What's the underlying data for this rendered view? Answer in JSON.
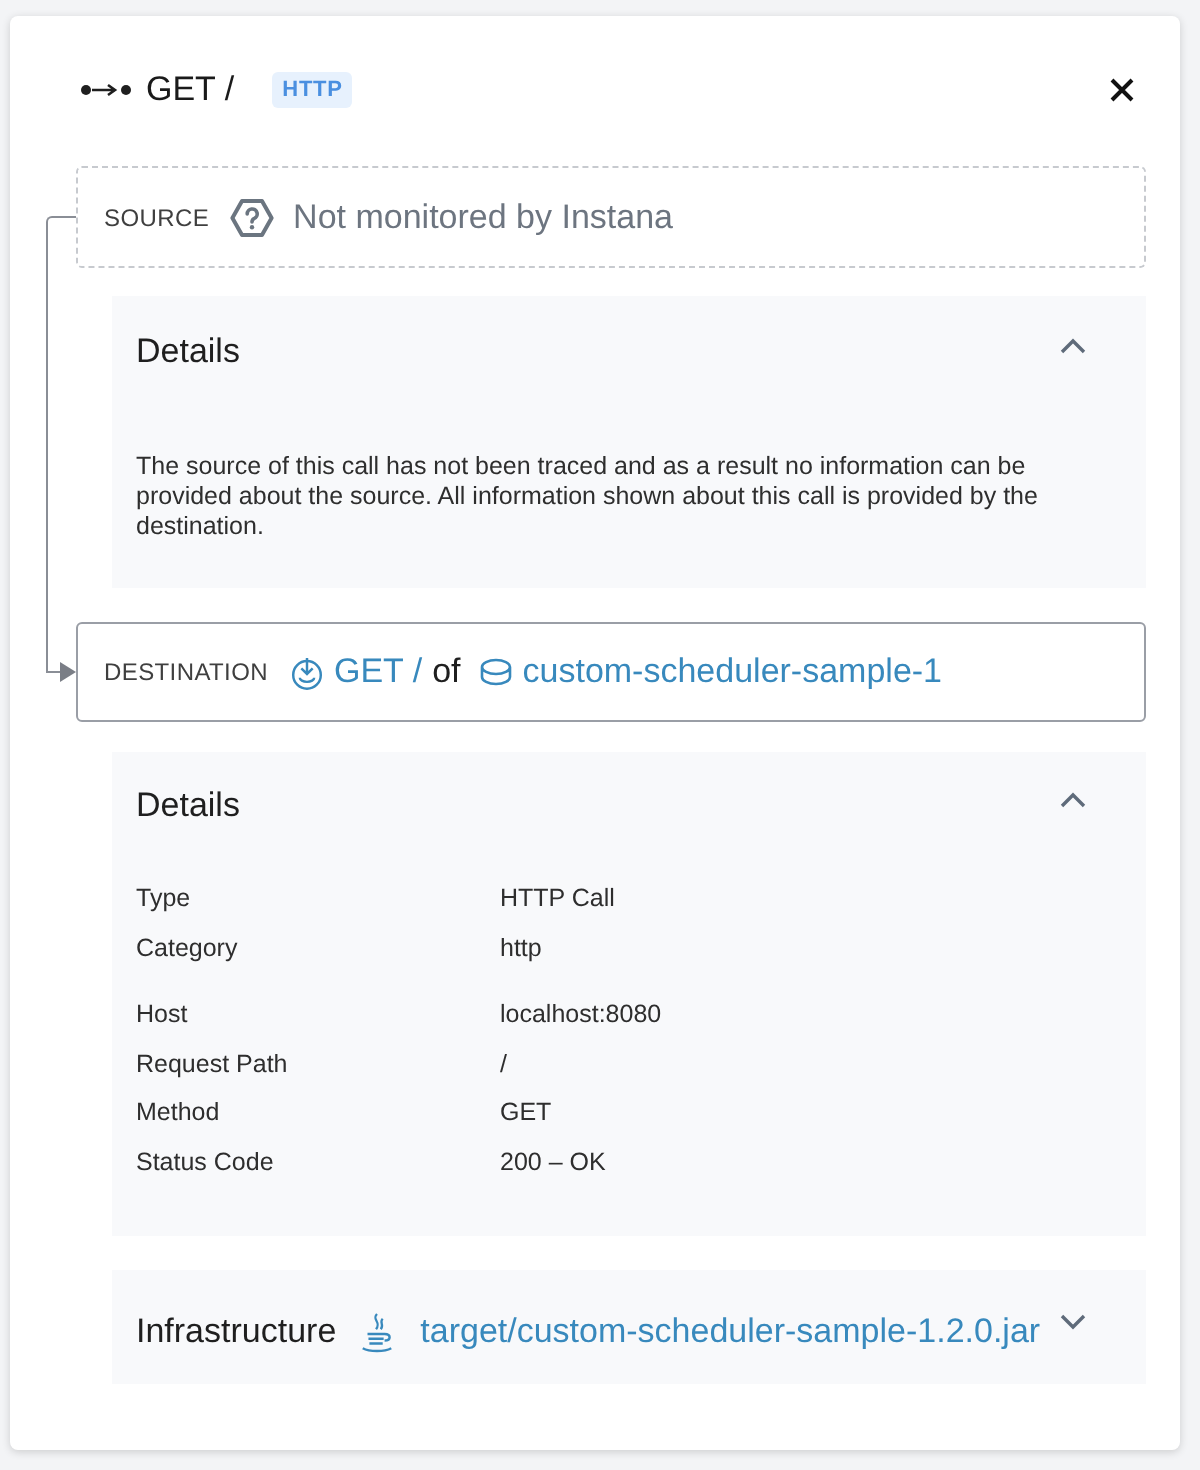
{
  "header": {
    "title": "GET /",
    "badge": "HTTP"
  },
  "source": {
    "label": "SOURCE",
    "text": "Not monitored by Instana"
  },
  "source_details": {
    "title": "Details",
    "expanded": true,
    "text": "The source of this call has not been traced and as a result no information can be provided about the source. All information shown about this call is provided by the destination."
  },
  "destination": {
    "label": "DESTINATION",
    "endpoint": "GET /",
    "joiner": "of",
    "service": "custom-scheduler-sample-1"
  },
  "destination_details": {
    "title": "Details",
    "expanded": true,
    "groups": [
      {
        "rows": [
          {
            "label": "Type",
            "value": "HTTP Call"
          },
          {
            "label": "Category",
            "value": "http"
          }
        ]
      },
      {
        "rows": [
          {
            "label": "Host",
            "value": "localhost:8080"
          },
          {
            "label": "Request Path",
            "value": "/"
          },
          {
            "label": "Method",
            "value": "GET"
          },
          {
            "label": "Status Code",
            "value": "200 – OK"
          }
        ]
      }
    ]
  },
  "infrastructure": {
    "title": "Infrastructure",
    "link": "target/custom-scheduler-sample-1.2.0.jar",
    "expanded": false
  }
}
